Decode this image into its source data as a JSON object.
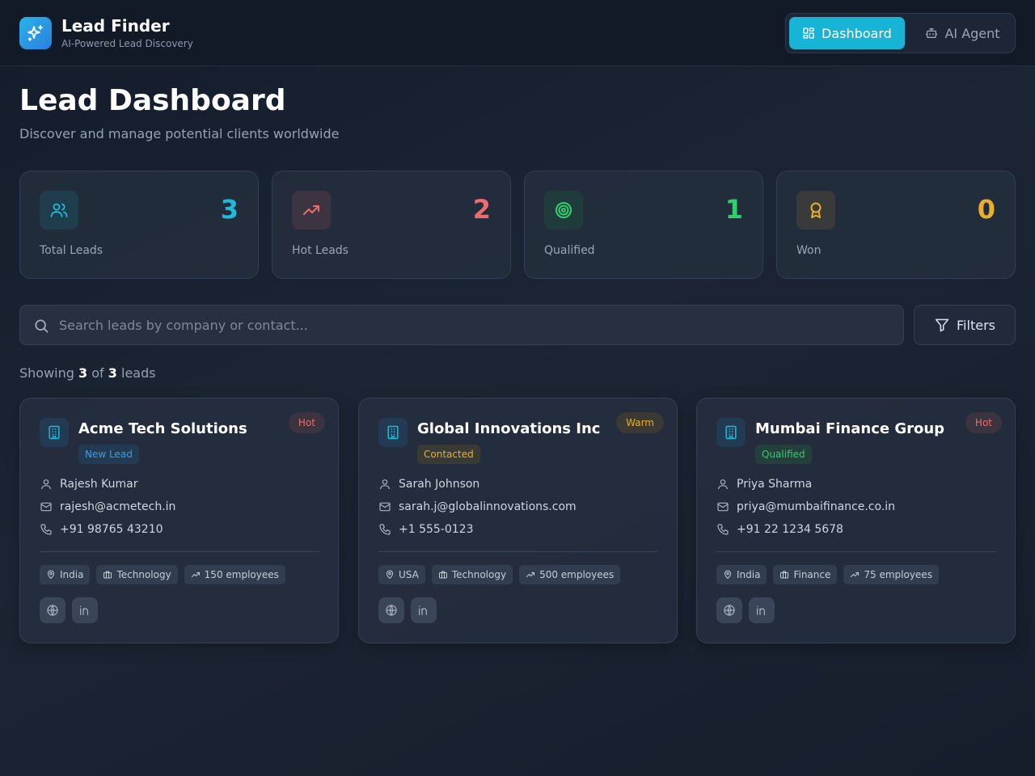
{
  "app": {
    "title": "Lead Finder",
    "subtitle": "AI-Powered Lead Discovery"
  },
  "nav": {
    "items": [
      {
        "label": "Dashboard",
        "icon": "dashboard-grid-icon",
        "active": true
      },
      {
        "label": "AI Agent",
        "icon": "bot-icon",
        "active": false
      }
    ]
  },
  "page": {
    "title": "Lead Dashboard",
    "subtitle": "Discover and manage potential clients worldwide"
  },
  "stats": [
    {
      "label": "Total Leads",
      "value": "3",
      "color": "#22b8d9",
      "icon": "users-icon"
    },
    {
      "label": "Hot Leads",
      "value": "2",
      "color": "#f06b6b",
      "icon": "trending-up-icon"
    },
    {
      "label": "Qualified",
      "value": "1",
      "color": "#2fcf6d",
      "icon": "target-icon"
    },
    {
      "label": "Won",
      "value": "0",
      "color": "#e8b02a",
      "icon": "award-icon"
    }
  ],
  "search": {
    "placeholder": "Search leads by company or contact...",
    "value": ""
  },
  "filters_label": "Filters",
  "showing": {
    "prefix": "Showing",
    "shown": "3",
    "of": "of",
    "total": "3",
    "suffix": "leads"
  },
  "leads": [
    {
      "company": "Acme Tech Solutions",
      "status": "New Lead",
      "temperature": "Hot",
      "contact": "Rajesh Kumar",
      "email": "rajesh@acmetech.in",
      "phone": "+91 98765 43210",
      "country": "India",
      "industry": "Technology",
      "employees": "150 employees"
    },
    {
      "company": "Global Innovations Inc",
      "status": "Contacted",
      "temperature": "Warm",
      "contact": "Sarah Johnson",
      "email": "sarah.j@globalinnovations.com",
      "phone": "+1 555-0123",
      "country": "USA",
      "industry": "Technology",
      "employees": "500 employees"
    },
    {
      "company": "Mumbai Finance Group",
      "status": "Qualified",
      "temperature": "Hot",
      "contact": "Priya Sharma",
      "email": "priya@mumbaifinance.co.in",
      "phone": "+91 22 1234 5678",
      "country": "India",
      "industry": "Finance",
      "employees": "75 employees"
    }
  ],
  "colors": {
    "accent": "#18b4d6",
    "hot": "#f06b6b",
    "warm": "#e8b02a",
    "new_lead": "#3b9fe0",
    "contacted": "#e8b02a",
    "qualified": "#2fcf6d"
  }
}
